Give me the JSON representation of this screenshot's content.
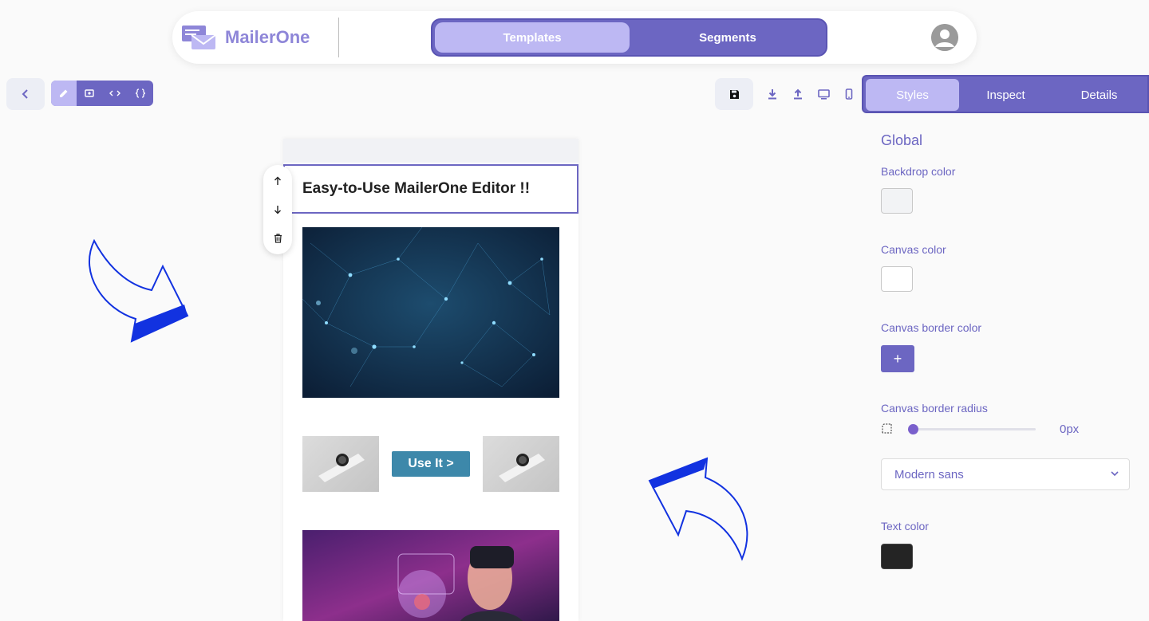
{
  "app": {
    "name": "MailerOne"
  },
  "nav": {
    "tabs": [
      {
        "label": "Templates",
        "active": true
      },
      {
        "label": "Segments",
        "active": false
      }
    ]
  },
  "toolbar": {
    "modes": [
      "edit-icon",
      "preview-icon",
      "code-icon",
      "json-icon"
    ],
    "right_icons": [
      "save-icon",
      "download-icon",
      "upload-icon",
      "desktop-icon",
      "mobile-icon"
    ]
  },
  "side_tabs": [
    {
      "label": "Styles",
      "active": true
    },
    {
      "label": "Inspect",
      "active": false
    },
    {
      "label": "Details",
      "active": false
    }
  ],
  "panel": {
    "title": "Global",
    "backdrop_label": "Backdrop color",
    "backdrop_color": "#F2F3F5",
    "canvas_label": "Canvas color",
    "canvas_color": "#FFFFFF",
    "border_color_label": "Canvas border color",
    "add_symbol": "+",
    "radius_label": "Canvas border radius",
    "radius_value": "0px",
    "font_value": "Modern sans",
    "text_color_label": "Text color",
    "text_color": "#242424"
  },
  "canvas": {
    "heading": "Easy-to-Use MailerOne Editor !!",
    "button_label": "Use It >"
  },
  "colors": {
    "accent": "#6C66C2",
    "accent_light": "#BDB8F3",
    "button_blue": "#3D88AA",
    "arrow_blue": "#1232E0"
  }
}
